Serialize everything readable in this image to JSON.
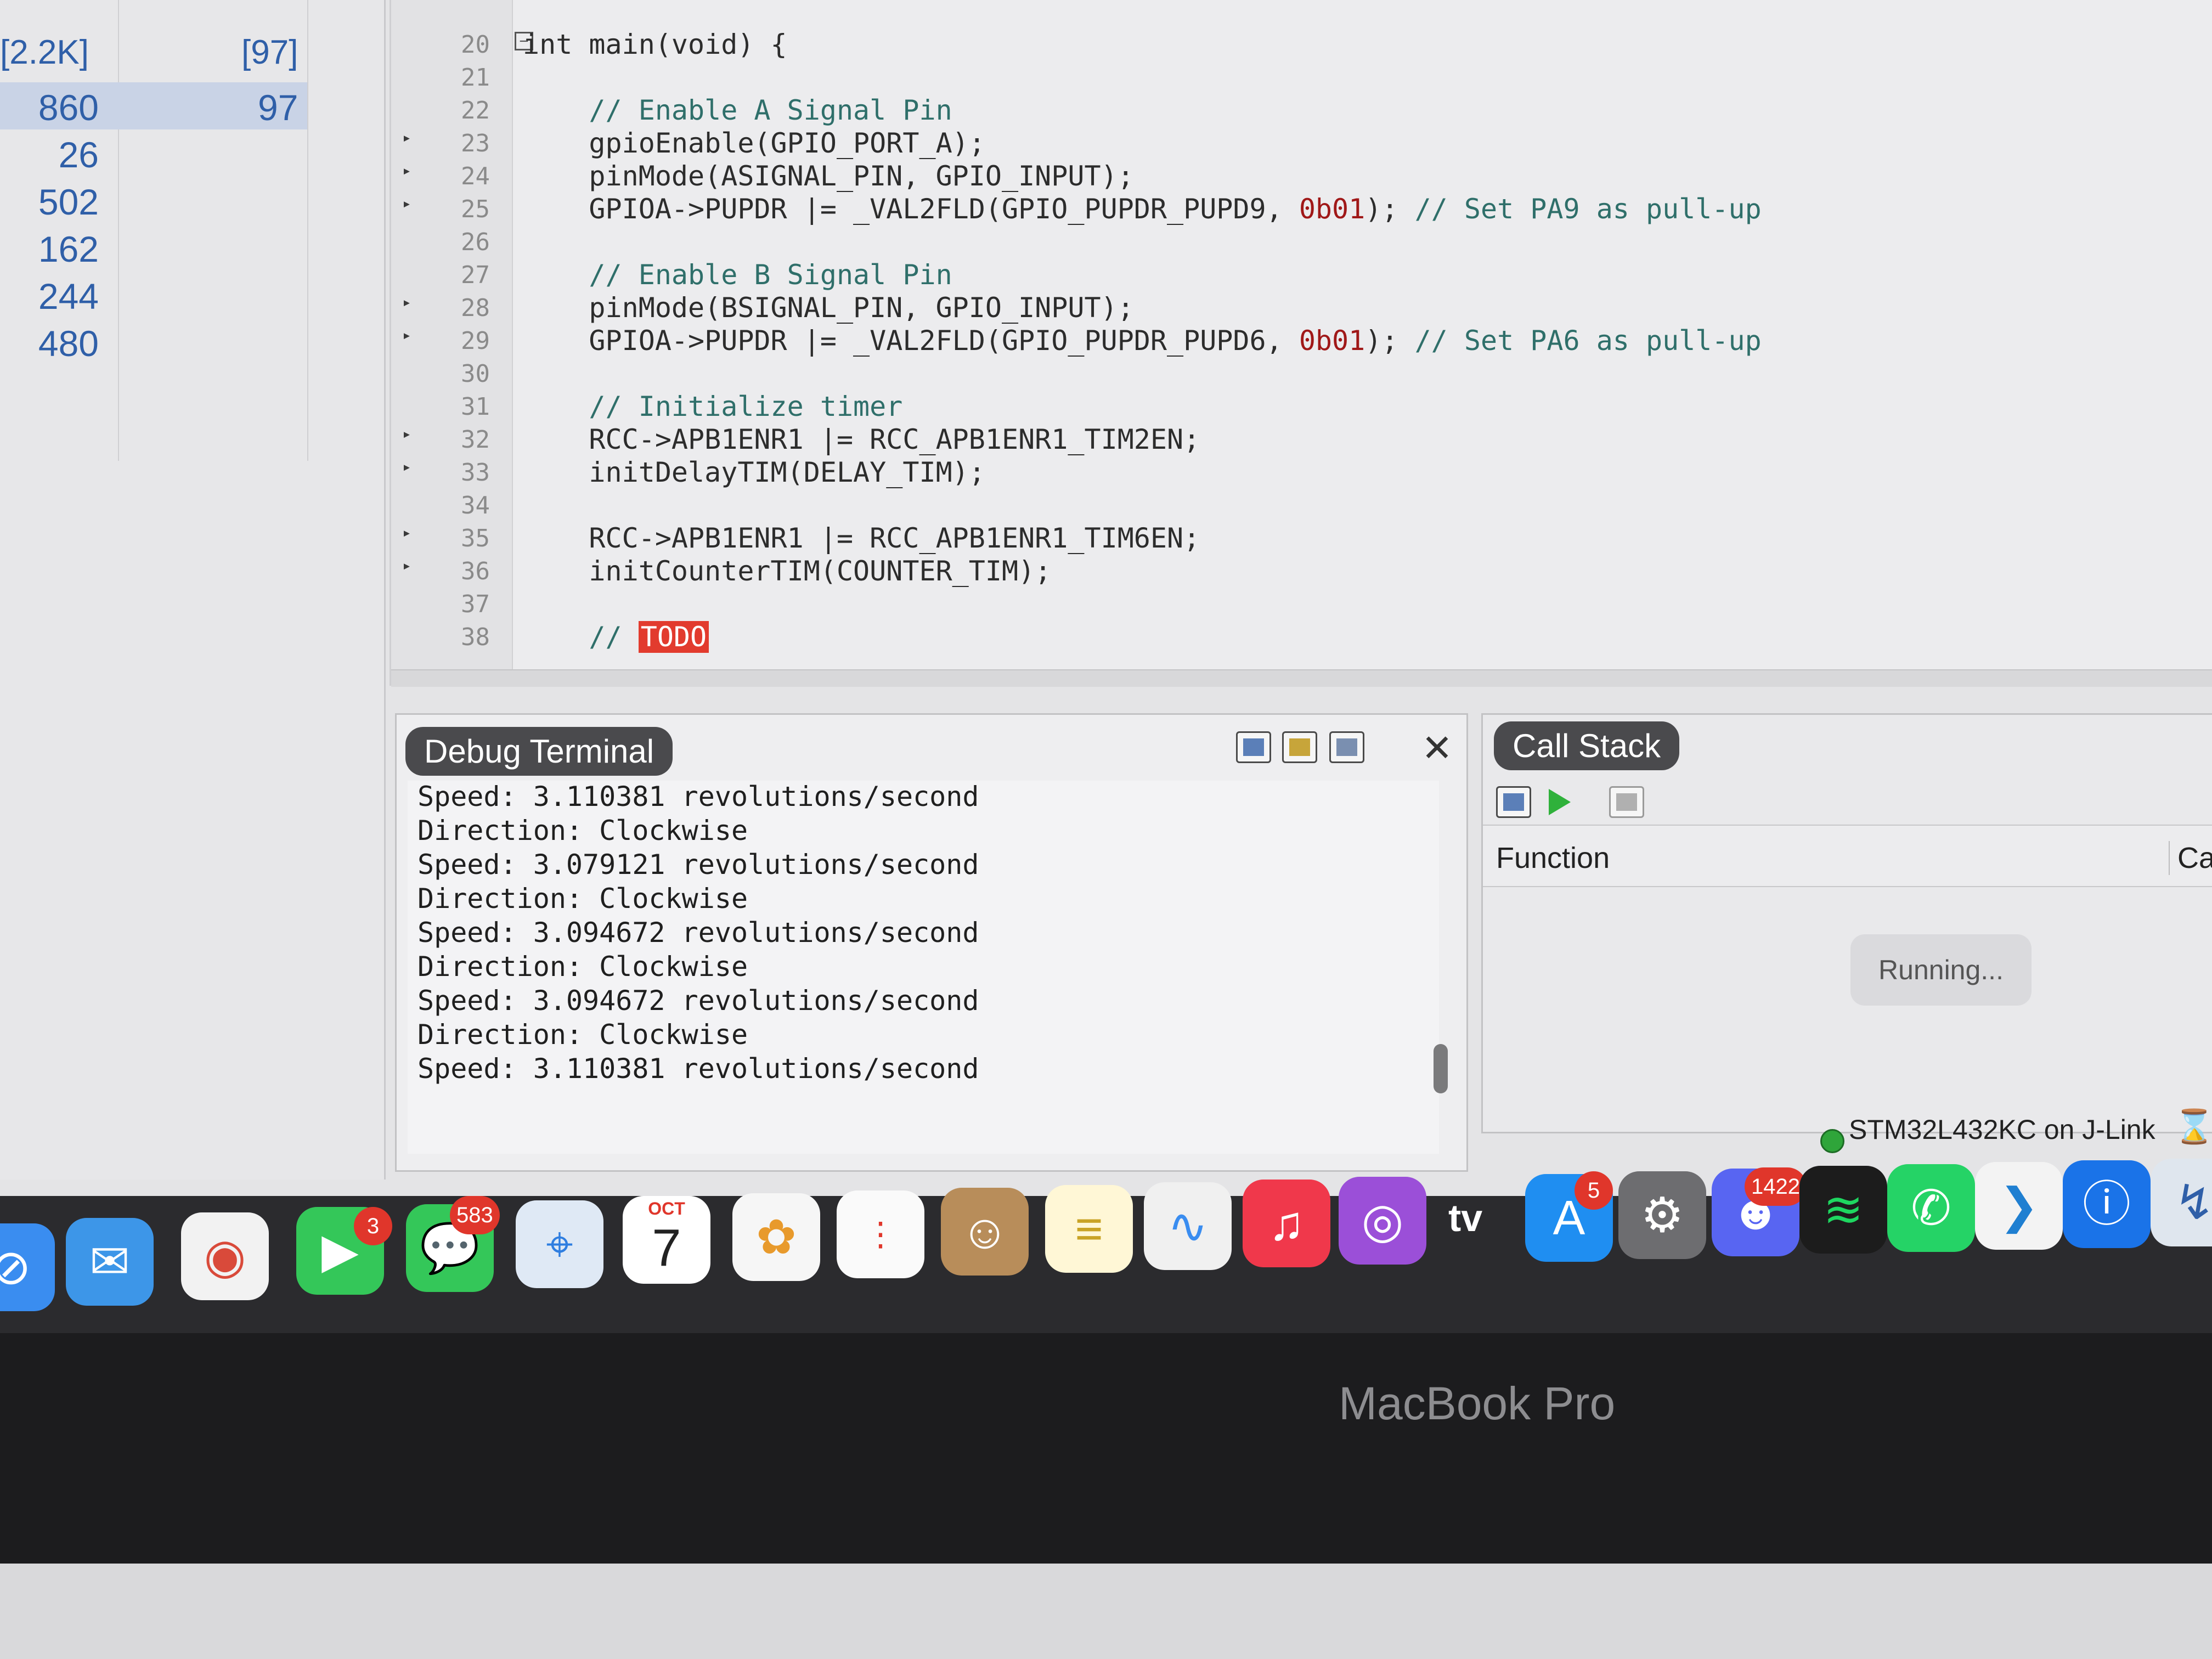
{
  "size_panel": {
    "header_left": "[2.2K]",
    "header_right": "[97]",
    "rows": [
      {
        "v1": "860",
        "v2": "97"
      },
      {
        "v1": "26",
        "v2": ""
      },
      {
        "v1": "502",
        "v2": ""
      },
      {
        "v1": "162",
        "v2": ""
      },
      {
        "v1": "244",
        "v2": ""
      },
      {
        "v1": "480",
        "v2": ""
      }
    ]
  },
  "editor": {
    "lines": [
      {
        "n": "20",
        "text": "int main(void) {"
      },
      {
        "n": "21",
        "text": ""
      },
      {
        "n": "22",
        "text": "    // Enable A Signal Pin"
      },
      {
        "n": "23",
        "text": "    gpioEnable(GPIO_PORT_A);"
      },
      {
        "n": "24",
        "text": "    pinMode(ASIGNAL_PIN, GPIO_INPUT);"
      },
      {
        "n": "25",
        "text": "    GPIOA->PUPDR |= _VAL2FLD(GPIO_PUPDR_PUPD9, 0b01); // Set PA9 as pull-up"
      },
      {
        "n": "26",
        "text": ""
      },
      {
        "n": "27",
        "text": "    // Enable B Signal Pin"
      },
      {
        "n": "28",
        "text": "    pinMode(BSIGNAL_PIN, GPIO_INPUT);"
      },
      {
        "n": "29",
        "text": "    GPIOA->PUPDR |= _VAL2FLD(GPIO_PUPDR_PUPD6, 0b01); // Set PA6 as pull-up"
      },
      {
        "n": "30",
        "text": ""
      },
      {
        "n": "31",
        "text": "    // Initialize timer"
      },
      {
        "n": "32",
        "text": "    RCC->APB1ENR1 |= RCC_APB1ENR1_TIM2EN;"
      },
      {
        "n": "33",
        "text": "    initDelayTIM(DELAY_TIM);"
      },
      {
        "n": "34",
        "text": ""
      },
      {
        "n": "35",
        "text": "    RCC->APB1ENR1 |= RCC_APB1ENR1_TIM6EN;"
      },
      {
        "n": "36",
        "text": "    initCounterTIM(COUNTER_TIM);"
      },
      {
        "n": "37",
        "text": ""
      },
      {
        "n": "38",
        "text": "    // TODO"
      }
    ]
  },
  "debug_terminal": {
    "title": "Debug Terminal",
    "close_glyph": "✕",
    "lines": [
      "Speed: 3.110381 revolutions/second",
      "Direction: Clockwise",
      "Speed: 3.079121 revolutions/second",
      "Direction: Clockwise",
      "Speed: 3.094672 revolutions/second",
      "Direction: Clockwise",
      "Speed: 3.094672 revolutions/second",
      "Direction: Clockwise",
      "Speed: 3.110381 revolutions/second"
    ]
  },
  "call_stack": {
    "title": "Call Stack",
    "col_function": "Function",
    "col_cal": "Cal",
    "running": "Running..."
  },
  "status_bar": {
    "target": "STM32L432KC on J-Link",
    "target_color": "#2fa53a"
  },
  "dock": {
    "facetime_badge": "3",
    "messages_badge": "583",
    "calendar_month": "OCT",
    "calendar_day": "7",
    "appletv_label": "tv",
    "appstore_badge": "5",
    "discord_badge": "1422"
  },
  "laptop": {
    "label": "MacBook Pro"
  }
}
